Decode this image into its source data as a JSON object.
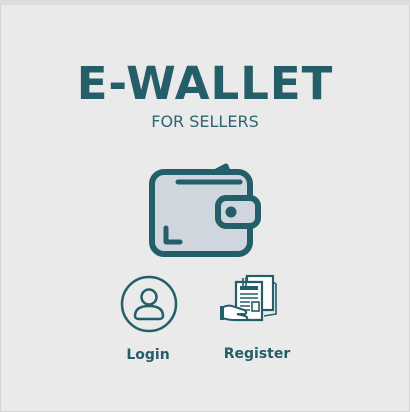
{
  "app": {
    "title": "E-WALLET",
    "subtitle": "FOR SELLERS"
  },
  "actions": {
    "login_label": "Login",
    "register_label": "Register"
  },
  "icons": {
    "logo": "wallet-icon",
    "login": "user-circle-icon",
    "register": "document-register-icon"
  },
  "colors": {
    "primary": "#245e68",
    "wallet_fill": "#cfd6dd",
    "cash_green": "#9ff0b4",
    "background": "#eaeaea"
  }
}
